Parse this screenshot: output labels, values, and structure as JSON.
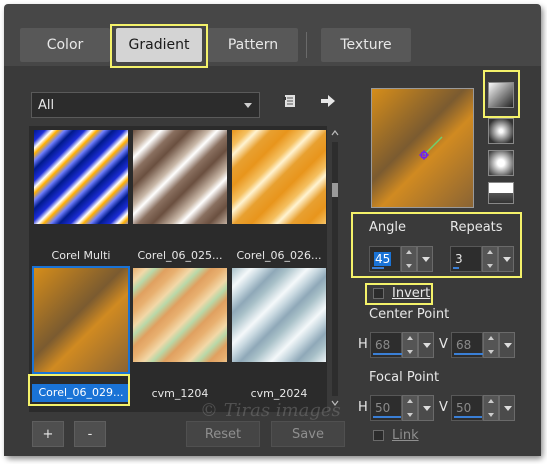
{
  "tabs": [
    {
      "label": "Color"
    },
    {
      "label": "Gradient"
    },
    {
      "label": "Pattern"
    },
    {
      "label": "Texture"
    }
  ],
  "library": {
    "dropdown_value": "All",
    "thumbnails": [
      {
        "caption": "Corel Multi"
      },
      {
        "caption": "Corel_06_025..."
      },
      {
        "caption": "Corel_06_026..."
      },
      {
        "caption": "Corel_06_029..."
      },
      {
        "caption": "cvm_1204"
      },
      {
        "caption": "cvm_2024"
      }
    ]
  },
  "controls": {
    "angle_label": "Angle",
    "angle_value": "45",
    "repeats_label": "Repeats",
    "repeats_value": "3",
    "invert_label": "Invert",
    "center_point_label": "Center Point",
    "center_h_label": "H",
    "center_h_value": "68",
    "center_v_label": "V",
    "center_v_value": "68",
    "focal_point_label": "Focal Point",
    "focal_h_label": "H",
    "focal_h_value": "50",
    "focal_v_label": "V",
    "focal_v_value": "50",
    "link_label": "Link"
  },
  "buttons": {
    "add": "+",
    "remove": "-",
    "reset": "Reset",
    "save": "Save"
  },
  "watermark": "© Tiras images",
  "colors": {
    "highlight": "#f4f26a",
    "selection": "#1a73d6",
    "panel": "#474747"
  }
}
